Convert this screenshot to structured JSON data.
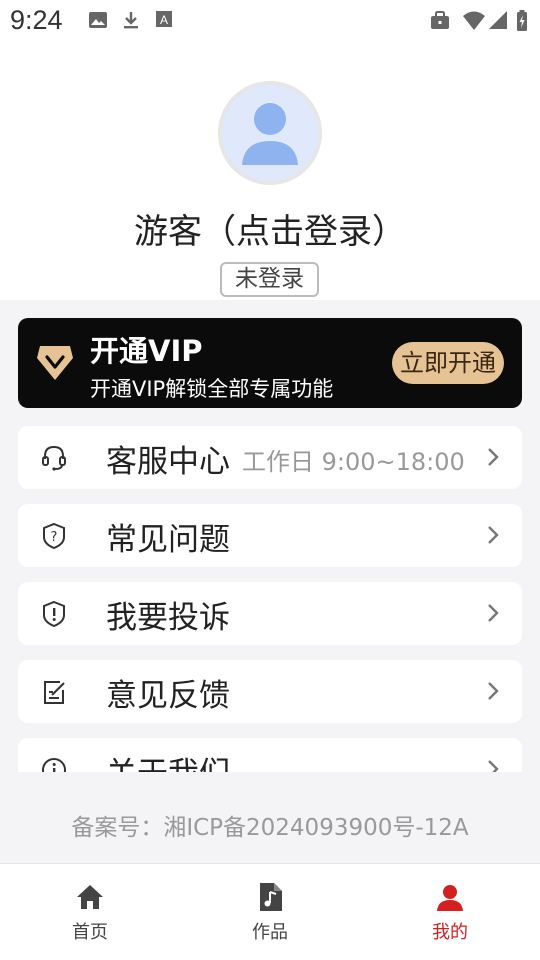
{
  "status_bar": {
    "time": "9:24",
    "left_icons": [
      "image-icon",
      "download-icon",
      "text-a-icon"
    ],
    "right_icons": [
      "briefcase-icon",
      "wifi-icon",
      "signal-icon",
      "battery-icon"
    ]
  },
  "profile": {
    "username": "游客（点击登录）",
    "login_status": "未登录",
    "avatar_icon": "user-avatar-icon"
  },
  "vip_banner": {
    "title": "开通VIP",
    "subtitle": "开通VIP解锁全部专属功能",
    "button_label": "立即开通",
    "accent_color": "#e6c395"
  },
  "menu": {
    "items": [
      {
        "label": "客服中心",
        "note": "工作日 9:00~18:00",
        "icon": "headset-icon"
      },
      {
        "label": "常见问题",
        "icon": "question-icon"
      },
      {
        "label": "我要投诉",
        "icon": "complaint-icon"
      },
      {
        "label": "意见反馈",
        "icon": "feedback-edit-icon"
      },
      {
        "label": "关于我们",
        "icon": "info-icon"
      }
    ]
  },
  "footer": {
    "beian": "备案号：湘ICP备2024093900号-12A"
  },
  "tabbar": {
    "active_color": "#d32020",
    "tabs": [
      {
        "label": "首页",
        "icon": "home-icon"
      },
      {
        "label": "作品",
        "icon": "music-file-icon"
      },
      {
        "label": "我的",
        "icon": "profile-icon",
        "active": true
      }
    ]
  }
}
